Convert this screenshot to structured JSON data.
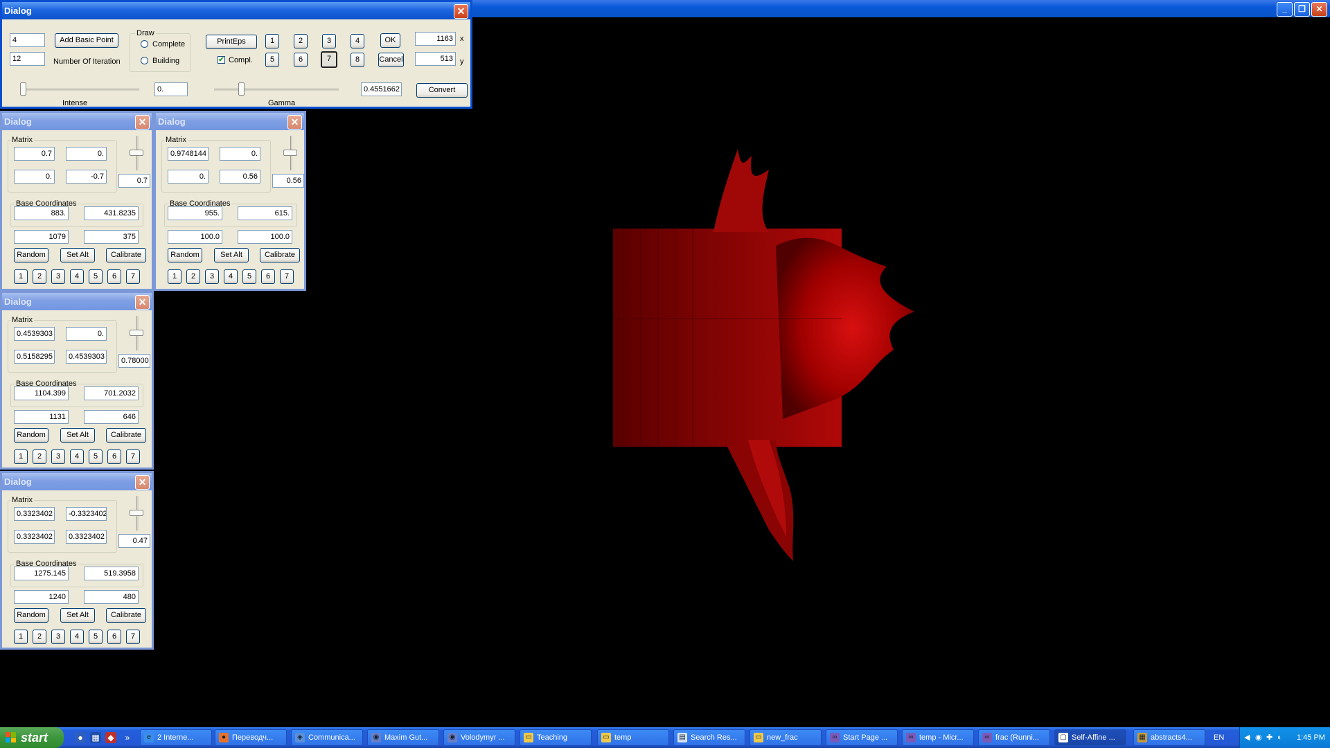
{
  "main_dialog": {
    "title": "Dialog",
    "basic_point_count": "4",
    "iterations": "12",
    "add_basic_point_label": "Add Basic Point",
    "number_of_iteration_label": "Number Of Iteration",
    "draw_group_title": "Draw",
    "draw_complete_label": "Complete",
    "draw_building_label": "Building",
    "print_eps_label": "PrintEps",
    "compl_label": "Compl.",
    "compl_checked": true,
    "number_buttons": [
      "1",
      "2",
      "3",
      "4",
      "5",
      "6",
      "7",
      "8"
    ],
    "pressed_button": "7",
    "ok_label": "OK",
    "cancel_label": "Cancel",
    "x_value": "1163",
    "x_label": "x",
    "y_value": "513",
    "y_label": "y",
    "intense_value": "0.",
    "intense_label": "Intense",
    "gamma_value": "0.4551662",
    "gamma_label": "Gamma",
    "convert_label": "Convert"
  },
  "transform_dialogs": [
    {
      "title": "Dialog",
      "matrix_title": "Matrix",
      "m": [
        "0.7",
        "0.",
        "0.",
        "-0.7"
      ],
      "scale": "0.7",
      "base_title": "Base Coordinates",
      "base": [
        "883.",
        "431.8235"
      ],
      "coords": [
        "1079",
        "375"
      ],
      "random_label": "Random",
      "setalt_label": "Set Alt",
      "calibrate_label": "Calibrate",
      "nums": [
        "1",
        "2",
        "3",
        "4",
        "5",
        "6",
        "7"
      ]
    },
    {
      "title": "Dialog",
      "matrix_title": "Matrix",
      "m": [
        "0.9748144",
        "0.",
        "0.",
        "0.56"
      ],
      "scale": "0.56",
      "base_title": "Base Coordinates",
      "base": [
        "955.",
        "615."
      ],
      "coords": [
        "100.0",
        "100.0"
      ],
      "random_label": "Random",
      "setalt_label": "Set Alt",
      "calibrate_label": "Calibrate",
      "nums": [
        "1",
        "2",
        "3",
        "4",
        "5",
        "6",
        "7"
      ]
    },
    {
      "title": "Dialog",
      "matrix_title": "Matrix",
      "m": [
        "0.4539303",
        "0.",
        "0.5158295",
        "0.4539303"
      ],
      "scale": "0.78000",
      "base_title": "Base Coordinates",
      "base": [
        "1104.399",
        "701.2032"
      ],
      "coords": [
        "1131",
        "646"
      ],
      "random_label": "Random",
      "setalt_label": "Set Alt",
      "calibrate_label": "Calibrate",
      "nums": [
        "1",
        "2",
        "3",
        "4",
        "5",
        "6",
        "7"
      ]
    },
    {
      "title": "Dialog",
      "matrix_title": "Matrix",
      "m": [
        "0.3323402",
        "-0.3323402",
        "0.3323402",
        "0.3323402"
      ],
      "scale": "0.47",
      "base_title": "Base Coordinates",
      "base": [
        "1275.145",
        "519.3958"
      ],
      "coords": [
        "1240",
        "480"
      ],
      "random_label": "Random",
      "setalt_label": "Set Alt",
      "calibrate_label": "Calibrate",
      "nums": [
        "1",
        "2",
        "3",
        "4",
        "5",
        "6",
        "7"
      ]
    }
  ],
  "taskbar": {
    "start_label": "start",
    "tasks": [
      {
        "label": "2 Interne...",
        "icon": "ie-icon"
      },
      {
        "label": "Переводч...",
        "icon": "firefox-icon"
      },
      {
        "label": "Communica...",
        "icon": "communicator-icon"
      },
      {
        "label": "Maxim Gut...",
        "icon": "chat-icon"
      },
      {
        "label": "Volodymyr ...",
        "icon": "chat-icon"
      },
      {
        "label": "Teaching",
        "icon": "folder-icon"
      },
      {
        "label": "temp",
        "icon": "folder-icon"
      },
      {
        "label": "Search Res...",
        "icon": "document-icon"
      },
      {
        "label": "new_frac",
        "icon": "folder-icon"
      },
      {
        "label": "Start Page ...",
        "icon": "visual-studio-icon"
      },
      {
        "label": "temp - Micr...",
        "icon": "visual-studio-icon"
      },
      {
        "label": "frac (Runni...",
        "icon": "visual-studio-icon"
      },
      {
        "label": "Self-Affine ...",
        "icon": "window-icon"
      },
      {
        "label": "abstracts4...",
        "icon": "archive-icon"
      }
    ],
    "active_task": "Self-Affine ...",
    "language": "EN",
    "clock": "1:45 PM"
  },
  "colors": {
    "fractal": "#c00000",
    "xp_blue": "#0a52cc",
    "dialog_bg": "#ece9d8"
  }
}
